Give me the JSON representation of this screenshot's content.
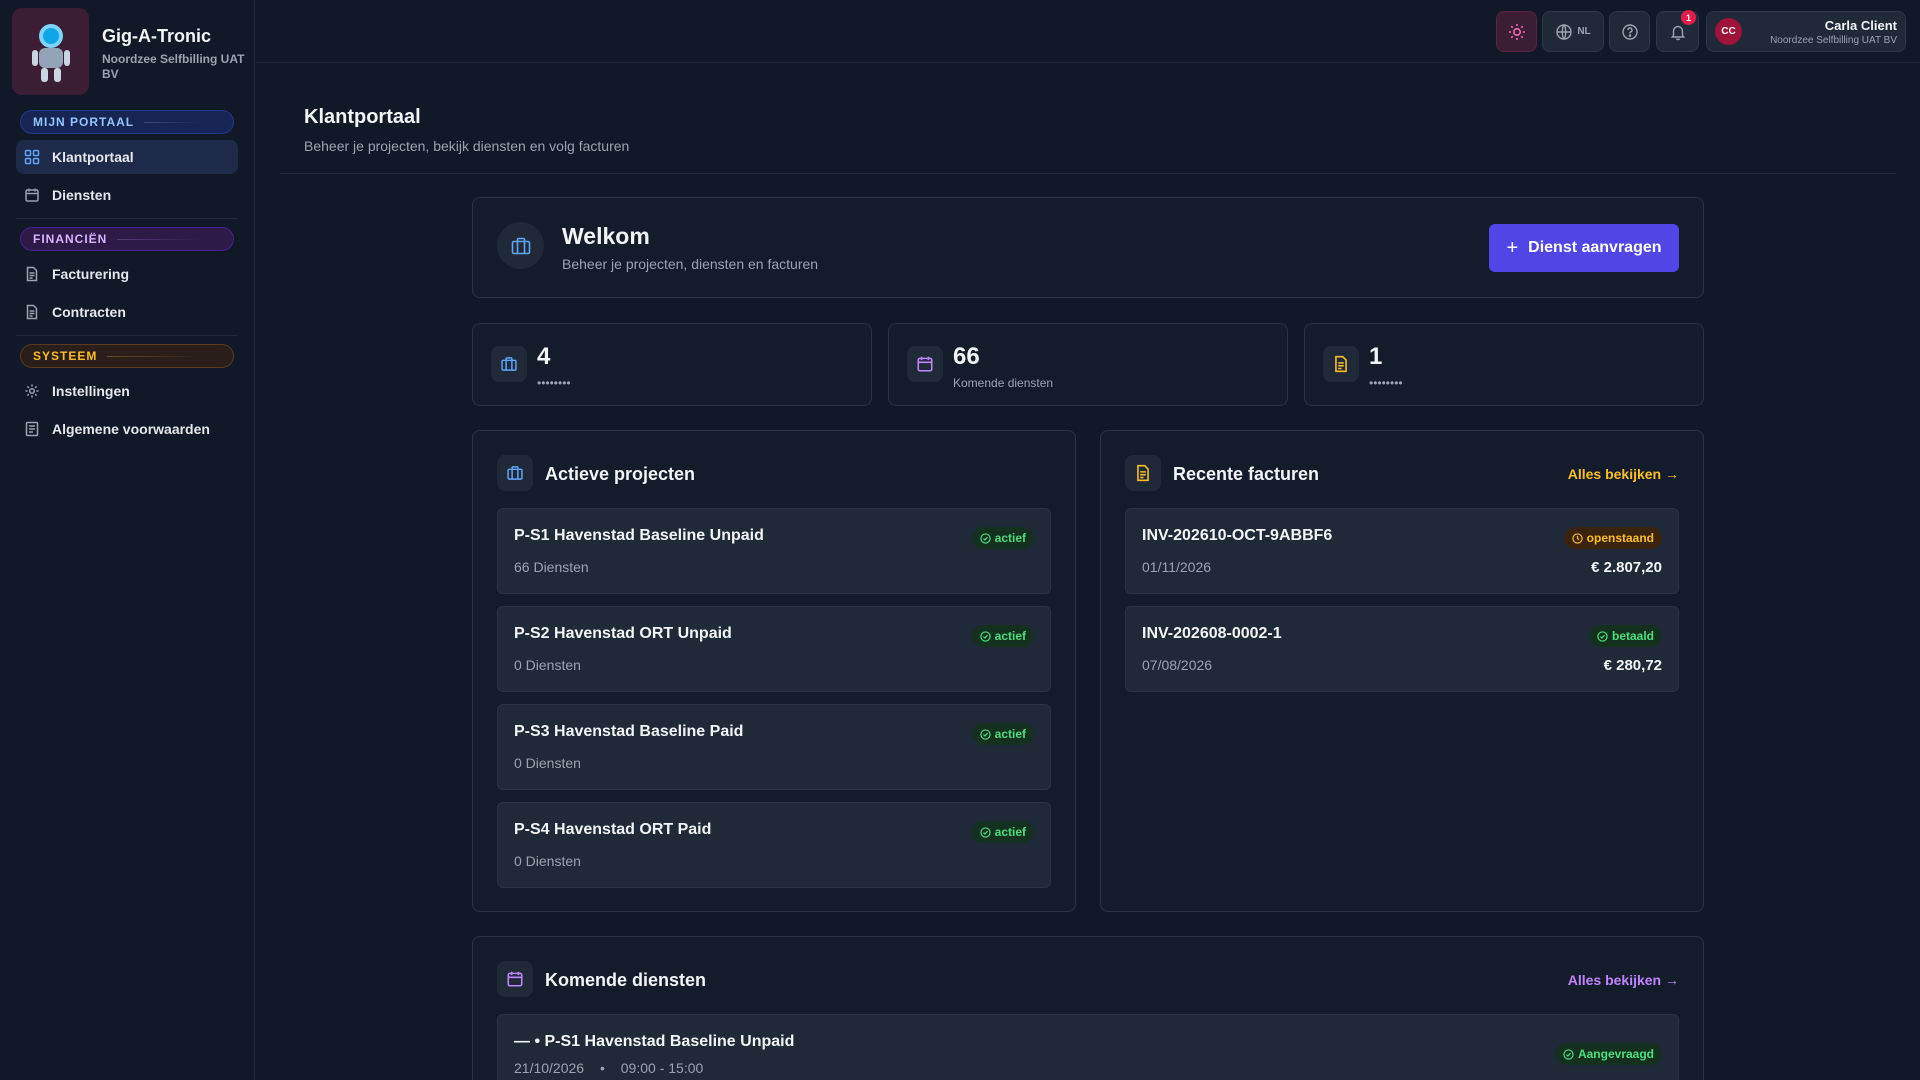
{
  "brand": {
    "name": "Gig-A-Tronic",
    "org": "Noordzee Selfbilling UAT BV"
  },
  "sidebar": {
    "sections": [
      {
        "label": "MIJN PORTAAL",
        "items": [
          {
            "label": "Klantportaal",
            "icon": "grid-icon",
            "active": true
          },
          {
            "label": "Diensten",
            "icon": "calendar-icon"
          }
        ]
      },
      {
        "label": "FINANCIËN",
        "items": [
          {
            "label": "Facturering",
            "icon": "document-icon"
          },
          {
            "label": "Contracten",
            "icon": "document-icon"
          }
        ]
      },
      {
        "label": "SYSTEEM",
        "items": [
          {
            "label": "Instellingen",
            "icon": "gear-icon"
          },
          {
            "label": "Algemene voorwaarden",
            "icon": "terms-icon"
          }
        ]
      }
    ]
  },
  "topbar": {
    "language": "NL",
    "notifications": "1",
    "user": {
      "initials": "CC",
      "name": "Carla Client",
      "org": "Noordzee Selfbilling UAT BV"
    }
  },
  "page": {
    "title": "Klantportaal",
    "subtitle": "Beheer je projecten, bekijk diensten en volg facturen"
  },
  "welcome": {
    "title": "Welkom",
    "subtitle": "Beheer je projecten, diensten en facturen",
    "button": "Dienst aanvragen"
  },
  "stats": [
    {
      "value": "4",
      "label": "••••••••",
      "icon": "briefcase-icon",
      "color": "#60a5fa"
    },
    {
      "value": "66",
      "label": "Komende diensten",
      "icon": "calendar-icon",
      "color": "#c084fc"
    },
    {
      "value": "1",
      "label": "••••••••",
      "icon": "document-icon",
      "color": "#fbbf24"
    }
  ],
  "projects": {
    "title": "Actieve projecten",
    "items": [
      {
        "name": "P-S1 Havenstad Baseline Unpaid",
        "services": "66 Diensten",
        "status": "actief"
      },
      {
        "name": "P-S2 Havenstad ORT Unpaid",
        "services": "0 Diensten",
        "status": "actief"
      },
      {
        "name": "P-S3 Havenstad Baseline Paid",
        "services": "0 Diensten",
        "status": "actief"
      },
      {
        "name": "P-S4 Havenstad ORT Paid",
        "services": "0 Diensten",
        "status": "actief"
      }
    ]
  },
  "invoices": {
    "title": "Recente facturen",
    "view_all": "Alles bekijken →",
    "items": [
      {
        "number": "INV-202610-OCT-9ABBF6",
        "date": "01/11/2026",
        "amount": "€ 2.807,20",
        "status": "openstaand"
      },
      {
        "number": "INV-202608-0002-1",
        "date": "07/08/2026",
        "amount": "€ 280,72",
        "status": "betaald"
      }
    ]
  },
  "upcoming": {
    "title": "Komende diensten",
    "view_all": "Alles bekijken →",
    "items": [
      {
        "title": "— • P-S1 Havenstad Baseline Unpaid",
        "date": "21/10/2026",
        "sep": "•",
        "time": "09:00 - 15:00",
        "status": "Aangevraagd"
      }
    ]
  },
  "colors": {
    "accent": "#4f46e5",
    "blue": "#60a5fa",
    "purple": "#c084fc",
    "amber": "#fbbf24",
    "green": "#4ade80"
  }
}
